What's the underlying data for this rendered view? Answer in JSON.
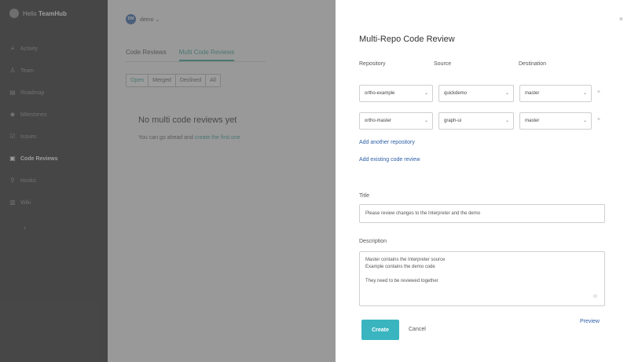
{
  "sidebar": {
    "brand_prefix": "Helix",
    "brand_name": "TeamHub",
    "items": [
      {
        "label": "Activity",
        "icon": "activity-icon",
        "glyph": "≡"
      },
      {
        "label": "Team",
        "icon": "team-icon",
        "glyph": "♙"
      },
      {
        "label": "Roadmap",
        "icon": "roadmap-icon",
        "glyph": "▤"
      },
      {
        "label": "Milestones",
        "icon": "milestone-icon",
        "glyph": "◆"
      },
      {
        "label": "Issues",
        "icon": "issues-icon",
        "glyph": "☑"
      },
      {
        "label": "Code Reviews",
        "icon": "code-review-icon",
        "glyph": "▣"
      },
      {
        "label": "Hooks",
        "icon": "hooks-icon",
        "glyph": "⚲"
      },
      {
        "label": "Wiki",
        "icon": "wiki-icon",
        "glyph": "▥"
      }
    ],
    "active_index": 5,
    "collapse_glyph": "‹"
  },
  "main": {
    "project_avatar": "DM",
    "project_name": "demo ⌄",
    "tabs": [
      {
        "label": "Code Reviews",
        "active": false
      },
      {
        "label": "Multi Code Reviews",
        "active": true
      }
    ],
    "filters": [
      {
        "label": "Open",
        "active": true
      },
      {
        "label": "Merged",
        "active": false
      },
      {
        "label": "Declined",
        "active": false
      },
      {
        "label": "All",
        "active": false
      }
    ],
    "empty_title": "No multi code reviews yet",
    "empty_text": "You can go ahead and",
    "empty_link": "create the first one"
  },
  "dialog": {
    "title": "Multi-Repo Code Review",
    "close_glyph": "×",
    "columns": {
      "repository": "Repository",
      "source": "Source",
      "destination": "Destination"
    },
    "rows": [
      {
        "repository": "ortho-example",
        "source": "quickdemo",
        "destination": "master"
      },
      {
        "repository": "ortho-master",
        "source": "graph-ui",
        "destination": "master"
      }
    ],
    "remove_glyph": "×",
    "chevron_glyph": "⌄",
    "add_repository": "Add another repository",
    "add_existing": "Add existing code review",
    "title_label": "Title",
    "title_value": "Please review changes to the Interpreter and the demo",
    "description_label": "Description",
    "description_lines": [
      "Master contains the Interpreter source",
      "Example contains the demo code",
      "",
      "They need to be reviewed together"
    ],
    "description_icon_glyph": "☺",
    "create_label": "Create",
    "cancel_label": "Cancel",
    "preview_label": "Preview"
  },
  "colors": {
    "accent": "#3ab5c0",
    "link": "#2d5ea8",
    "sidebar_bg": "#1f1f1f"
  }
}
